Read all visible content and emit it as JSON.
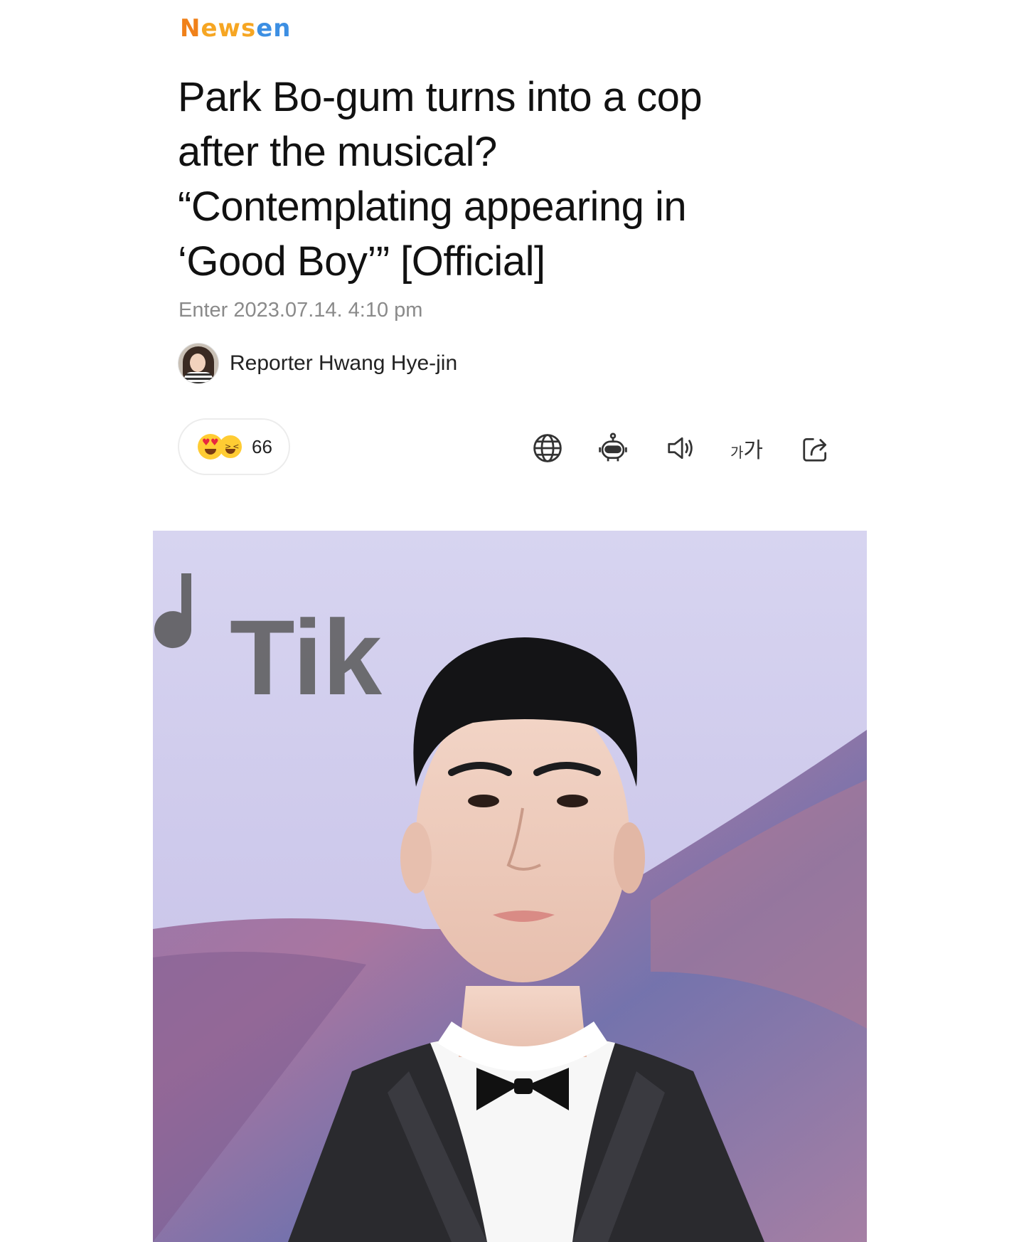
{
  "brand": {
    "part1": "N",
    "part2": "ews",
    "part3": "en"
  },
  "article": {
    "headline_lines": [
      "Park Bo-gum turns into a cop",
      "after the musical?",
      "“Contemplating appearing in",
      "‘Good Boy’” [Official]"
    ],
    "date_label": "Enter",
    "date_value": "2023.07.14. 4:10 pm",
    "reporter": "Reporter Hwang Hye-jin"
  },
  "reactions": {
    "count": "66",
    "emojis": [
      "heart-eyes-emoji",
      "laughing-emoji"
    ]
  },
  "toolbar": {
    "items": [
      "globe-icon",
      "robot-icon",
      "speaker-icon",
      "font-size-icon",
      "share-icon"
    ],
    "font_small": "가",
    "font_large": "가"
  },
  "photo": {
    "backdrop_text": "Tik"
  }
}
